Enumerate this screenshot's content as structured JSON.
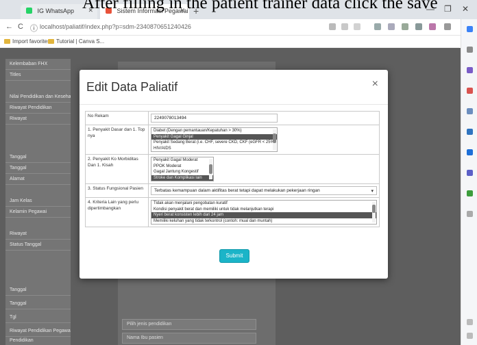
{
  "caption": "After filling in the patient trainer data click the save",
  "browser": {
    "tabs": [
      {
        "label": "IG WhatsApp",
        "favicon_color": "#25d366"
      },
      {
        "label": "Sistem Informasi Pegawai",
        "favicon_color": "#e8523a"
      }
    ],
    "new_tab": "+",
    "window_controls": [
      "—",
      "❐",
      "✕"
    ],
    "nav": [
      "←",
      "C",
      "ⓘ"
    ],
    "url": "localhost/paliatif/index.php?p=sdm-2340870651240426",
    "bookmarks": [
      {
        "label": "Import favorites"
      },
      {
        "label": "Tutorial | Canva S..."
      }
    ]
  },
  "background": {
    "sidebar_rows": [
      "Kelembaban FHX",
      "Titles",
      "Nilai Pendidikan dan Kesehatan",
      "Riwayat Pendidikan",
      "Riwayat",
      "Tanggal",
      "Tanggal",
      "Alamat",
      "Jam Kelas",
      "Kelamin Pegawai",
      "Riwayat",
      "Status Tanggal",
      "Tanggal",
      "Tanggal",
      "Tgl",
      "Riwayat Pendidikan Pegawai",
      "Pendidikan"
    ],
    "bottom_select": "Pilih jenis pendidikan",
    "bottom_input": "Nama Ibu pasien"
  },
  "modal": {
    "title": "Edit Data Paliatif",
    "close": "×",
    "fields": [
      {
        "label": "No Rekam",
        "value": "2249078013494"
      },
      {
        "label": "1. Penyakit Dasar dan 1. Top nya",
        "options": [
          "Diabet (Dengan pemantauan/Kepatuhan > 30%)",
          "Penyakit Gagal Ginjal",
          "Penyakit Sedang Berat (i.e. CHF, severe CKD, CKF (eGFR < 25%)",
          "HIV/AIDS"
        ],
        "selected_index": 1
      },
      {
        "label": "2. Penyakit Ko Morbiditas Dan 1. Kisah",
        "options": [
          "Penyakit Gagal Moderat",
          "PPOK Moderat",
          "Gagal Jantung Kongestif",
          "Stroke dan Komplikasi lain"
        ],
        "selected_index": 3
      },
      {
        "label": "3. Status Fungsional Pasien",
        "value": "Terbatas kemampuan dalam aktifitas berat tetapi dapat melakukan pekerjaan ringan"
      },
      {
        "label": "4. Kriteria Lain yang perlu dipertimbangkan",
        "options": [
          "Tidak akan menjalani pengobatan kuratif",
          "Kondisi penyakit berat dan memiliki untuk tidak melanjutkan terapi",
          "Nyeri berat konsisten lebih dari 24 jam",
          "Memiliki keluhan yang tidak terkontrol (contoh: mual dan muntah)"
        ],
        "selected_index": 2
      }
    ],
    "submit": "Submit"
  }
}
